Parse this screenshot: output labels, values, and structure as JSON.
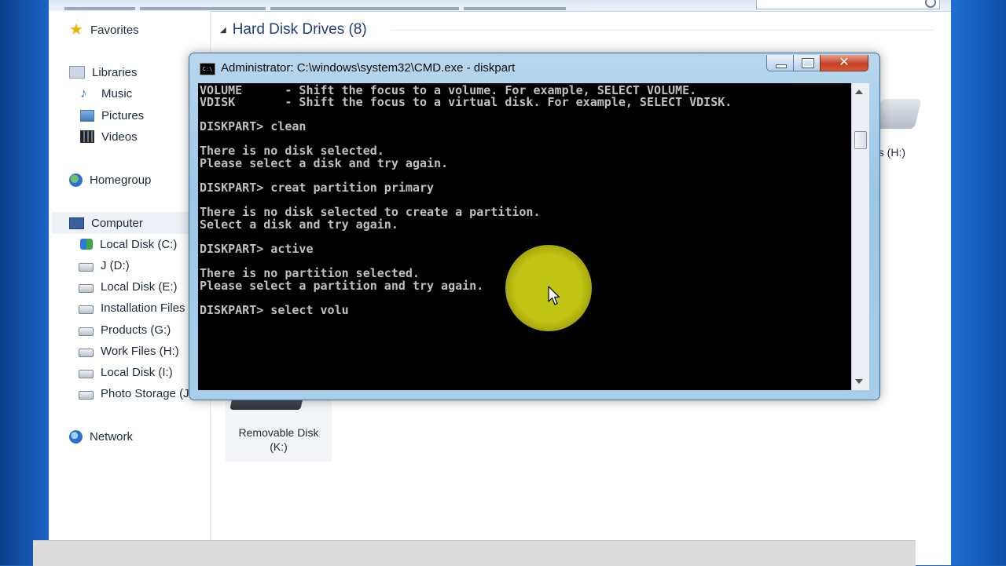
{
  "explorer": {
    "nav": {
      "favorites": "Favorites",
      "libraries": "Libraries",
      "music": "Music",
      "pictures": "Pictures",
      "videos": "Videos",
      "homegroup": "Homegroup",
      "computer": "Computer",
      "drives": [
        "Local Disk (C:)",
        "J (D:)",
        "Local Disk (E:)",
        "Installation Files",
        "Products (G:)",
        "Work Files (H:)",
        "Local Disk (I:)",
        "Photo Storage (J"
      ],
      "network": "Network"
    },
    "group_header": "Hard Disk Drives (8)",
    "partial_drive_label": "es (H:)",
    "removable_disk": {
      "line1": "Removable Disk",
      "line2": "(K:)"
    }
  },
  "cmd": {
    "title": "Administrator: C:\\windows\\system32\\CMD.exe - diskpart",
    "icon_text": "C:\\",
    "close_label": "✕",
    "lines": [
      "VOLUME      - Shift the focus to a volume. For example, SELECT VOLUME.",
      "VDISK       - Shift the focus to a virtual disk. For example, SELECT VDISK.",
      "",
      "DISKPART> clean",
      "",
      "There is no disk selected.",
      "Please select a disk and try again.",
      "",
      "DISKPART> creat partition primary",
      "",
      "There is no disk selected to create a partition.",
      "Select a disk and try again.",
      "",
      "DISKPART> active",
      "",
      "There is no partition selected.",
      "Please select a partition and try again.",
      "",
      "DISKPART> select volu"
    ]
  },
  "colors": {
    "console_bg": "#000000",
    "console_text": "#c0c0c0",
    "cursor_highlight": "#cdce14",
    "titlebar": "#9cc6e6",
    "close_button": "#c64025"
  }
}
